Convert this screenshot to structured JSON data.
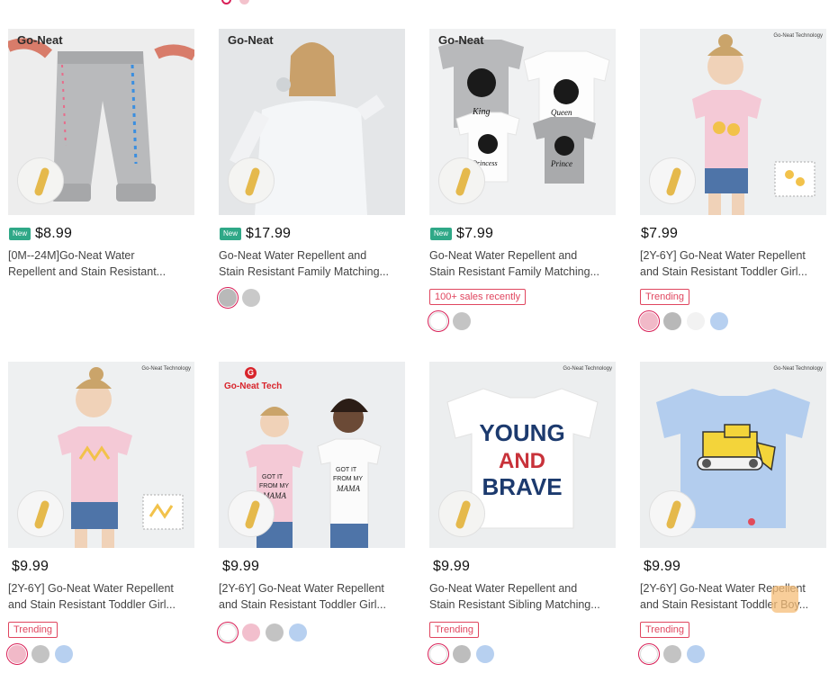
{
  "products": [
    {
      "brand": "Go-Neat",
      "badge": "New",
      "price": "$8.99",
      "title_line1": "[0M--24M]Go-Neat Water",
      "title_line2": "Repellent and Stain Resistant...",
      "tag": "",
      "colors": [
        "#ffffff",
        "#c7c7c7"
      ],
      "selected": 0
    },
    {
      "brand": "Go-Neat",
      "badge": "New",
      "price": "$17.99",
      "title_line1": "Go-Neat Water Repellent and",
      "title_line2": "Stain Resistant Family Matching...",
      "tag": "",
      "colors": [
        "#b9b9b9",
        "#c9c9c9"
      ],
      "selected": 0
    },
    {
      "brand": "Go-Neat",
      "badge": "New",
      "price": "$7.99",
      "title_line1": "Go-Neat Water Repellent and",
      "title_line2": "Stain Resistant Family Matching...",
      "tag": "100+ sales recently",
      "colors": [
        "#ffffff",
        "#c4c4c4"
      ],
      "selected": 0
    },
    {
      "brand": "Go-Neat Technology",
      "badge": "",
      "price": "$7.99",
      "title_line1": "[2Y-6Y] Go-Neat Water Repellent",
      "title_line2": "and Stain Resistant Toddler Girl...",
      "tag": "Trending",
      "colors": [
        "#f1b9c8",
        "#b8b8b8",
        "#f2f2f2",
        "#b7d0f0"
      ],
      "selected": 0
    },
    {
      "brand": "Go-Neat Technology",
      "badge": "",
      "price": "$9.99",
      "title_line1": "[2Y-6Y] Go-Neat Water Repellent",
      "title_line2": "and Stain Resistant Toddler Girl...",
      "tag": "Trending",
      "colors": [
        "#f1b9c8",
        "#c3c3c3",
        "#b7d0f0"
      ],
      "selected": 0
    },
    {
      "brand": "Go-Neat Tech",
      "badge": "",
      "price": "$9.99",
      "title_line1": "[2Y-6Y] Go-Neat Water Repellent",
      "title_line2": "and Stain Resistant Toddler Girl...",
      "tag": "",
      "colors": [
        "#ffffff",
        "#f2bfcd",
        "#c3c3c3",
        "#b7d0f0"
      ],
      "selected": 0
    },
    {
      "brand": "Go-Neat Technology",
      "badge": "",
      "price": "$9.99",
      "title_line1": "Go-Neat Water Repellent and",
      "title_line2": "Stain Resistant Sibling Matching...",
      "tag": "Trending",
      "colors": [
        "#ffffff",
        "#bdbdbd",
        "#b7d0f0"
      ],
      "selected": 0
    },
    {
      "brand": "Go-Neat Technology",
      "badge": "",
      "price": "$9.99",
      "title_line1": "[2Y-6Y] Go-Neat Water Repellent",
      "title_line2": "and Stain Resistant Toddler Boy...",
      "tag": "Trending",
      "colors": [
        "#ffffff",
        "#c3c3c3",
        "#b7d0f0"
      ],
      "selected": 0
    }
  ],
  "shirt_texts": {
    "king": "King",
    "queen": "Queen",
    "princess": "Princess",
    "prince": "Prince",
    "got_it": "GOT IT",
    "from_my": "FROM MY",
    "mama": "MAMA",
    "young": "YOUNG",
    "and": "AND",
    "brave": "BRAVE"
  },
  "accent_color": "#d81e56",
  "new_badge_color": "#2fa887"
}
